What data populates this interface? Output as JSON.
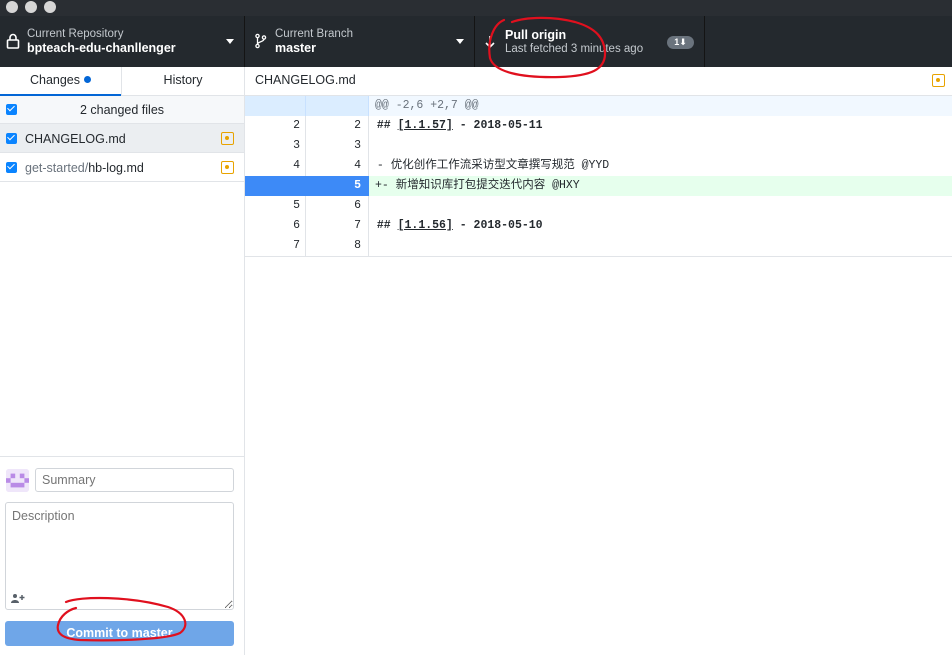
{
  "toolbar": {
    "repository": {
      "title": "Current Repository",
      "name": "bpteach-edu-chanllenger"
    },
    "branch": {
      "title": "Current Branch",
      "name": "master"
    },
    "pull": {
      "title": "Pull origin",
      "description": "Last fetched 3 minutes ago",
      "badge": "1"
    }
  },
  "sidebar": {
    "tabs": [
      {
        "label": "Changes"
      },
      {
        "label": "History"
      }
    ],
    "changed_files_label": "2 changed files",
    "files": [
      {
        "dir": "",
        "name": "CHANGELOG.md"
      },
      {
        "dir": "get-started/",
        "name": "hb-log.md"
      }
    ]
  },
  "commit": {
    "summary_placeholder": "Summary",
    "description_placeholder": "Description",
    "button_label": "Commit to master"
  },
  "diff": {
    "file_path": "CHANGELOG.md",
    "hunk_header": "@@ -2,6 +2,7 @@",
    "lines": [
      {
        "old": "2",
        "new": "2",
        "prefix": " ",
        "head": "## ",
        "link": "[1.1.57]",
        "tail": " - 2018-05-11"
      },
      {
        "old": "3",
        "new": "3",
        "text": ""
      },
      {
        "old": "4",
        "new": "4",
        "text": " - 优化创作工作流采访型文章撰写规范 @YYD"
      },
      {
        "old": "",
        "new": "5",
        "text": "+- 新增知识库打包提交迭代内容 @HXY"
      },
      {
        "old": "5",
        "new": "6",
        "text": ""
      },
      {
        "old": "6",
        "new": "7",
        "prefix": " ",
        "head": "## ",
        "link": "[1.1.56]",
        "tail": " - 2018-05-10"
      },
      {
        "old": "7",
        "new": "8",
        "text": ""
      }
    ]
  },
  "colors": {
    "accent": "#0366d6",
    "modified": "#e8a300",
    "added_bg": "#e6ffed",
    "selected_line": "#3d8af7",
    "annotation": "#e0101e"
  }
}
